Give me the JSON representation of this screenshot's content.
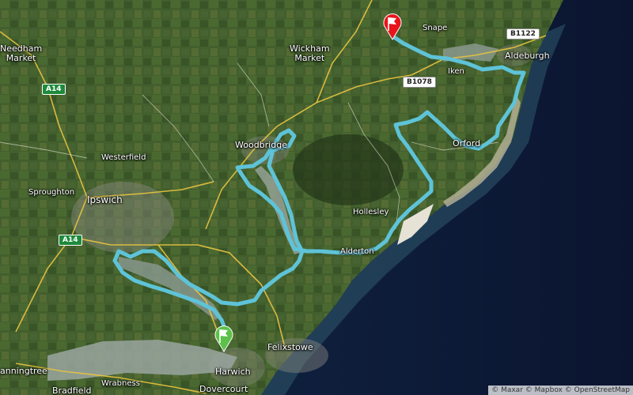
{
  "places": [
    {
      "id": "needham-market",
      "text": "Needham\nMarket"
    },
    {
      "id": "wickham-market",
      "text": "Wickham\nMarket"
    },
    {
      "id": "snape",
      "text": "Snape"
    },
    {
      "id": "aldeburgh",
      "text": "Aldeburgh"
    },
    {
      "id": "iken",
      "text": "Iken"
    },
    {
      "id": "woodbridge",
      "text": "Woodbridge"
    },
    {
      "id": "westerfield",
      "text": "Westerfield"
    },
    {
      "id": "ipswich",
      "text": "Ipswich"
    },
    {
      "id": "sproughton",
      "text": "Sproughton"
    },
    {
      "id": "orford",
      "text": "Orford"
    },
    {
      "id": "hollesley",
      "text": "Hollesley"
    },
    {
      "id": "alderton",
      "text": "Alderton"
    },
    {
      "id": "felixstowe",
      "text": "Felixstowe"
    },
    {
      "id": "harwich",
      "text": "Harwich"
    },
    {
      "id": "dovercourt",
      "text": "Dovercourt"
    },
    {
      "id": "manningtree",
      "text": "anningtree"
    },
    {
      "id": "wrabness",
      "text": "Wrabness"
    },
    {
      "id": "bradfield",
      "text": "Bradfield"
    }
  ],
  "roads": [
    {
      "id": "a14-north",
      "text": "A14",
      "kind": "a"
    },
    {
      "id": "a14-south",
      "text": "A14",
      "kind": "a"
    },
    {
      "id": "b1078",
      "text": "B1078",
      "kind": "b"
    },
    {
      "id": "b1122",
      "text": "B1122",
      "kind": "b"
    }
  ],
  "markers": {
    "start": {
      "name": "start",
      "color": "#5cc14a"
    },
    "finish": {
      "name": "finish",
      "color": "#e8141c"
    }
  },
  "route_color": "#5ec3d8",
  "attribution": "© Maxar © Mapbox © OpenStreetMap"
}
